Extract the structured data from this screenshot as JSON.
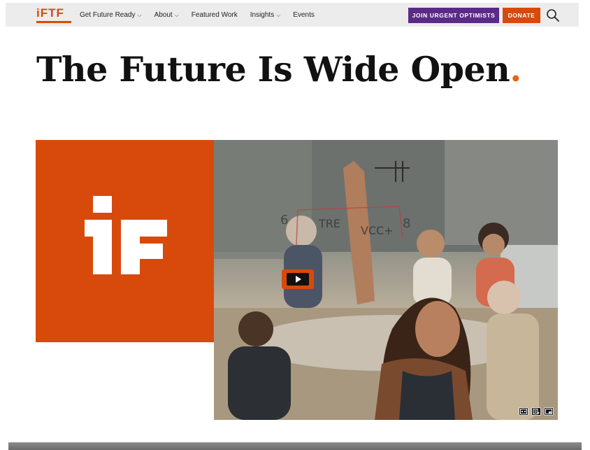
{
  "nav": {
    "logo_text": "iFTF",
    "items": [
      {
        "label": "Get Future Ready",
        "has_dropdown": true
      },
      {
        "label": "About",
        "has_dropdown": true
      },
      {
        "label": "Featured Work",
        "has_dropdown": false
      },
      {
        "label": "Insights",
        "has_dropdown": true
      },
      {
        "label": "Events",
        "has_dropdown": false
      }
    ],
    "join_label": "JOIN URGENT OPTIMISTS",
    "donate_label": "DONATE",
    "search_icon": "search-icon"
  },
  "hero": {
    "headline": "The Future Is Wide Open",
    "headline_dot": ".",
    "brand_logo": "iF",
    "video": {
      "play_icon": "play-icon",
      "controls": [
        "closed-captions-icon",
        "transcript-icon",
        "picture-in-picture-icon"
      ]
    }
  },
  "colors": {
    "brand_orange": "#d84a0c",
    "purple": "#5b2a86",
    "nav_bg": "#ececec"
  }
}
